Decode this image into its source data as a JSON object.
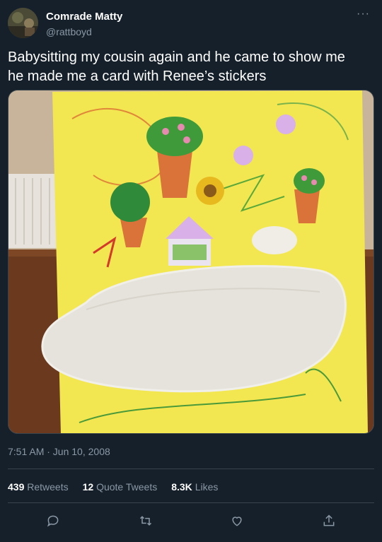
{
  "user": {
    "display_name": "Comrade Matty",
    "handle": "@rattboyd",
    "avatar_icon": "avatar-photo"
  },
  "header": {
    "more_icon": "more-dots-icon",
    "more_label": "···"
  },
  "tweet": {
    "text_line1": "Babysitting my cousin again and he came to show me",
    "text_line2": "he made me a card with Renee’s stickers",
    "timestamp": "7:51 AM · Jun 10, 2008"
  },
  "stats": {
    "retweets_count": "439",
    "retweets_label": "Retweets",
    "quotes_count": "12",
    "quotes_label": "Quote Tweets",
    "likes_count": "8.3K",
    "likes_label": "Likes"
  },
  "actions": [
    {
      "icon": "reply-icon"
    },
    {
      "icon": "retweet-icon"
    },
    {
      "icon": "like-icon"
    },
    {
      "icon": "share-icon"
    }
  ],
  "colors": {
    "background": "#15202b",
    "secondary_text": "#8b98a5",
    "divider": "#38444d",
    "card_yellow": "#f2e651"
  }
}
